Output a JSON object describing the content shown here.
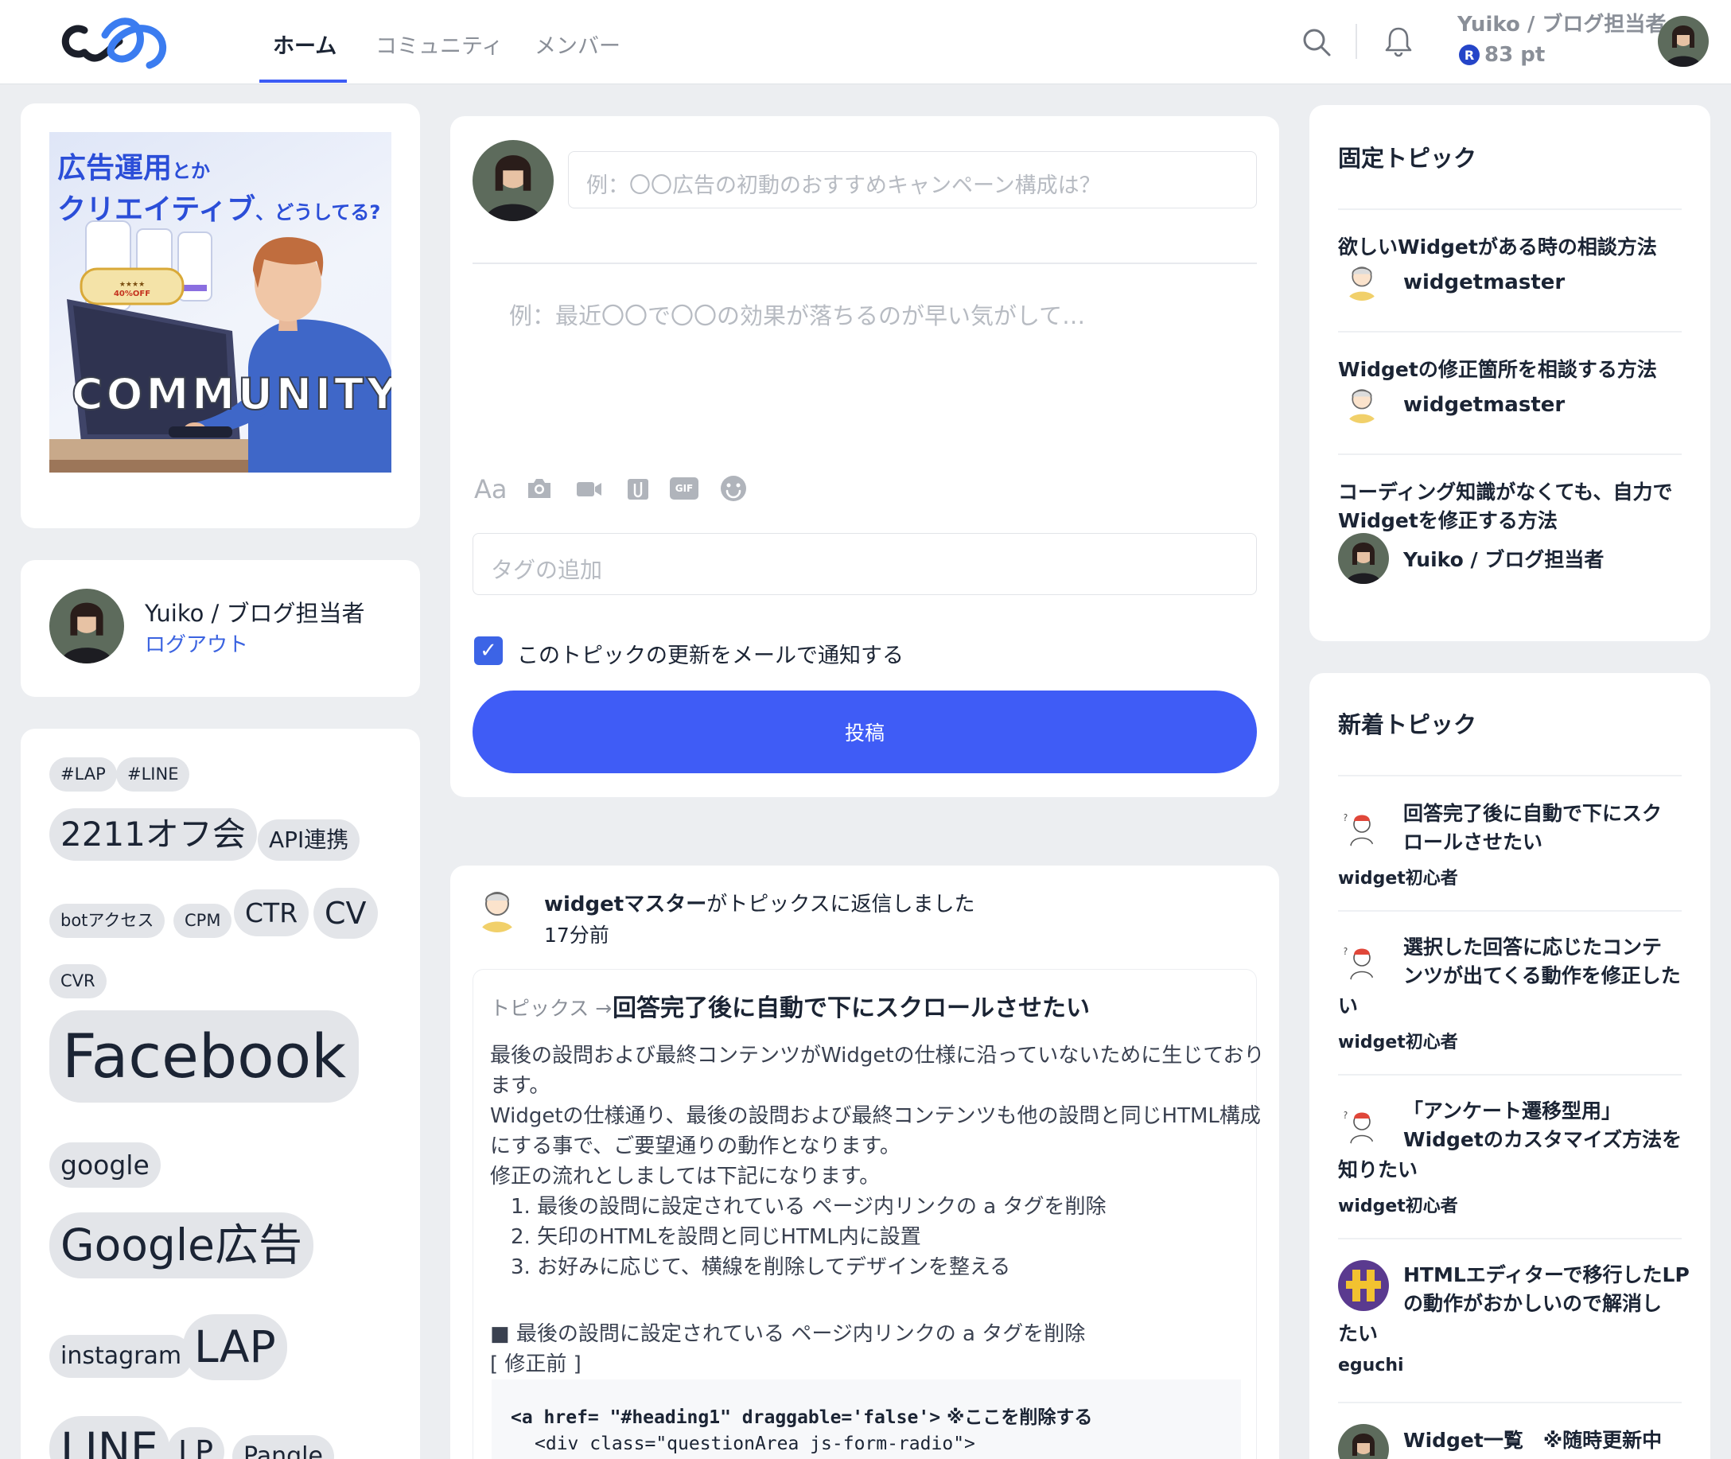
{
  "header": {
    "nav": [
      "ホーム",
      "コミュニティ",
      "メンバー"
    ],
    "user_name": "Yuiko / ブログ担当者",
    "points": "83 pt",
    "points_badge": "R"
  },
  "left": {
    "banner": {
      "line1": "広告運用",
      "line1_small": "とか",
      "line2": "クリエイティブ",
      "line2_small": "、どうしてる?",
      "coupon": "40%OFF",
      "community": "COMMUNITY"
    },
    "profile": {
      "name": "Yuiko / ブログ担当者",
      "logout": "ログアウト"
    },
    "tags": [
      "#LAP",
      "#LINE",
      "2211オフ会",
      "API連携",
      "botアクセス",
      "CPM",
      "CTR",
      "CV",
      "CVR",
      "Facebook",
      "google",
      "Google広告",
      "instagram",
      "LAP",
      "LINE",
      "LP",
      "Pangle"
    ]
  },
  "composer": {
    "title_placeholder": "例：〇〇広告の初動のおすすめキャンペーン構成は？",
    "body_placeholder": "例：最近〇〇で〇〇の効果が落ちるのが早い気がして…",
    "tools": [
      "text-format",
      "camera",
      "video",
      "attachment",
      "gif",
      "emoji"
    ],
    "tool_text": "Aa",
    "gif_label": "GIF",
    "tag_placeholder": "タグの追加",
    "notify_label": "このトピックの更新をメールで通知する",
    "notify_checked": true,
    "check_mark": "✓",
    "post_button": "投稿"
  },
  "activity": {
    "actor": "widgetマスター",
    "action": "がトピックスに返信しました",
    "time": "17分前",
    "breadcrumb": "トピックス →",
    "topic_title": "回答完了後に自動で下にスクロールさせたい",
    "body_lines": [
      "最後の設問および最終コンテンツがWidgetの仕様に沿っていないために生じており",
      "ます。",
      "Widgetの仕様通り、最後の設問および最終コンテンツも他の設問と同じHTML構成",
      "にする事で、ご要望通りの動作となります。",
      "修正の流れとしましては下記になります。",
      "　1. 最後の設問に設定されている ページ内リンクの a タグを削除",
      "　2. 矢印のHTMLを設問と同じHTML内に設置",
      "　3. お好みに応じて、横線を削除してデザインを整える"
    ],
    "section_heading": "■ 最後の設問に設定されている ページ内リンクの a タグを削除",
    "section_sub": "[ 修正前 ]",
    "code_line1_tag": "<a href= \"#heading1\" draggable='false'>",
    "code_line1_note": " ※ここを削除する",
    "code_line2": "<div class=\"questionArea js-form-radio\">"
  },
  "pinned": {
    "title": "固定トピック",
    "items": [
      {
        "title": "欲しいWidgetがある時の相談方法",
        "author": "widgetmaster"
      },
      {
        "title": "Widgetの修正箇所を相談する方法",
        "author": "widgetmaster"
      },
      {
        "title_lines": [
          "コーディング知識がなくても、自力で",
          "Widgetを修正する方法"
        ],
        "author": "Yuiko / ブログ担当者"
      }
    ]
  },
  "recent": {
    "title": "新着トピック",
    "items": [
      {
        "lines": [
          "回答完了後に自動で下にスク",
          "ロールさせたい"
        ],
        "wrap": "",
        "author": "widget初心者"
      },
      {
        "lines": [
          "選択した回答に応じたコンテ",
          "ンツが出てくる動作を修正した"
        ],
        "wrap": "い",
        "author": "widget初心者"
      },
      {
        "lines": [
          "「アンケート遷移型用」",
          "Widgetのカスタマイズ方法を"
        ],
        "wrap": "知りたい",
        "author": "widget初心者"
      },
      {
        "lines": [
          "HTMLエディターで移行したLP",
          "の動作がおかしいので解消し"
        ],
        "wrap": "たい",
        "author": "eguchi"
      },
      {
        "lines": [
          "Widget一覧　※随時更新中"
        ],
        "wrap": "",
        "author": ""
      }
    ]
  },
  "colors": {
    "accent": "#3f5cf6",
    "link": "#3b63e0",
    "background": "#eceef1"
  }
}
